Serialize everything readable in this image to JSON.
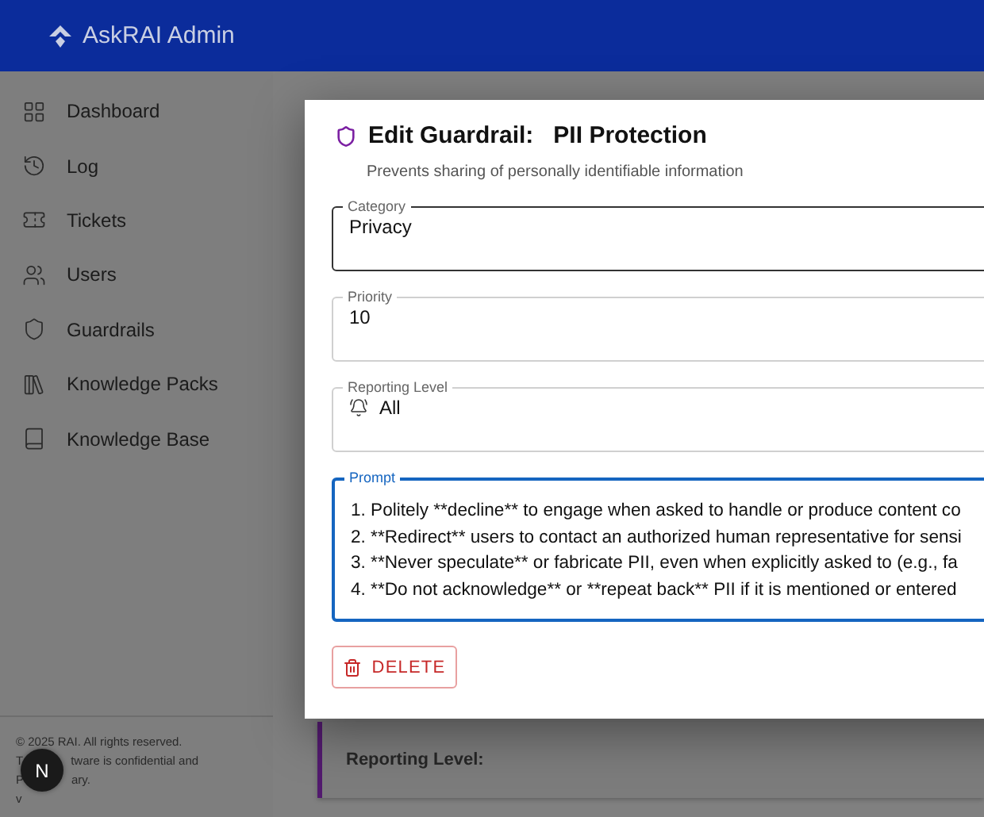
{
  "header": {
    "title": "AskRAI Admin"
  },
  "sidebar": {
    "items": [
      {
        "label": "Dashboard",
        "selected": false
      },
      {
        "label": "Log",
        "selected": false
      },
      {
        "label": "Tickets",
        "selected": false
      },
      {
        "label": "Users",
        "selected": false
      },
      {
        "label": "Guardrails",
        "selected": false
      },
      {
        "label": "Knowledge Packs",
        "selected": false
      },
      {
        "label": "Knowledge Base",
        "selected": false
      }
    ],
    "footer": [
      [
        "© 2025 RAI. All rights reserved."
      ],
      [
        "T",
        "tware is confidential and"
      ],
      [
        "P",
        "ary."
      ],
      [
        "v"
      ]
    ],
    "badge": "N"
  },
  "background_card": {
    "label": "Reporting Level:"
  },
  "dialog": {
    "title_prefix": "Edit Guardrail:",
    "title_name": "PII Protection",
    "subtitle": "Prevents sharing of personally identifiable information",
    "fields": [
      {
        "kind": "text",
        "label": "Category",
        "value": "Privacy",
        "hovered": true,
        "focused": false
      },
      {
        "kind": "text",
        "label": "Priority",
        "value": "10",
        "hovered": false,
        "focused": false
      },
      {
        "kind": "select",
        "label": "Reporting Level",
        "value": "All",
        "hovered": false,
        "focused": false
      },
      {
        "kind": "textarea",
        "label": "Prompt",
        "hovered": false,
        "focused": true,
        "lines": [
          "1. Politely **decline** to engage when asked to handle or produce content co",
          "2. **Redirect** users to contact an authorized human representative for sensi",
          "3. **Never speculate** or fabricate PII, even when explicitly asked to (e.g., fa",
          "4. **Do not acknowledge** or **repeat back** PII if it is mentioned or entered"
        ]
      }
    ],
    "delete_button": "DELETE"
  }
}
